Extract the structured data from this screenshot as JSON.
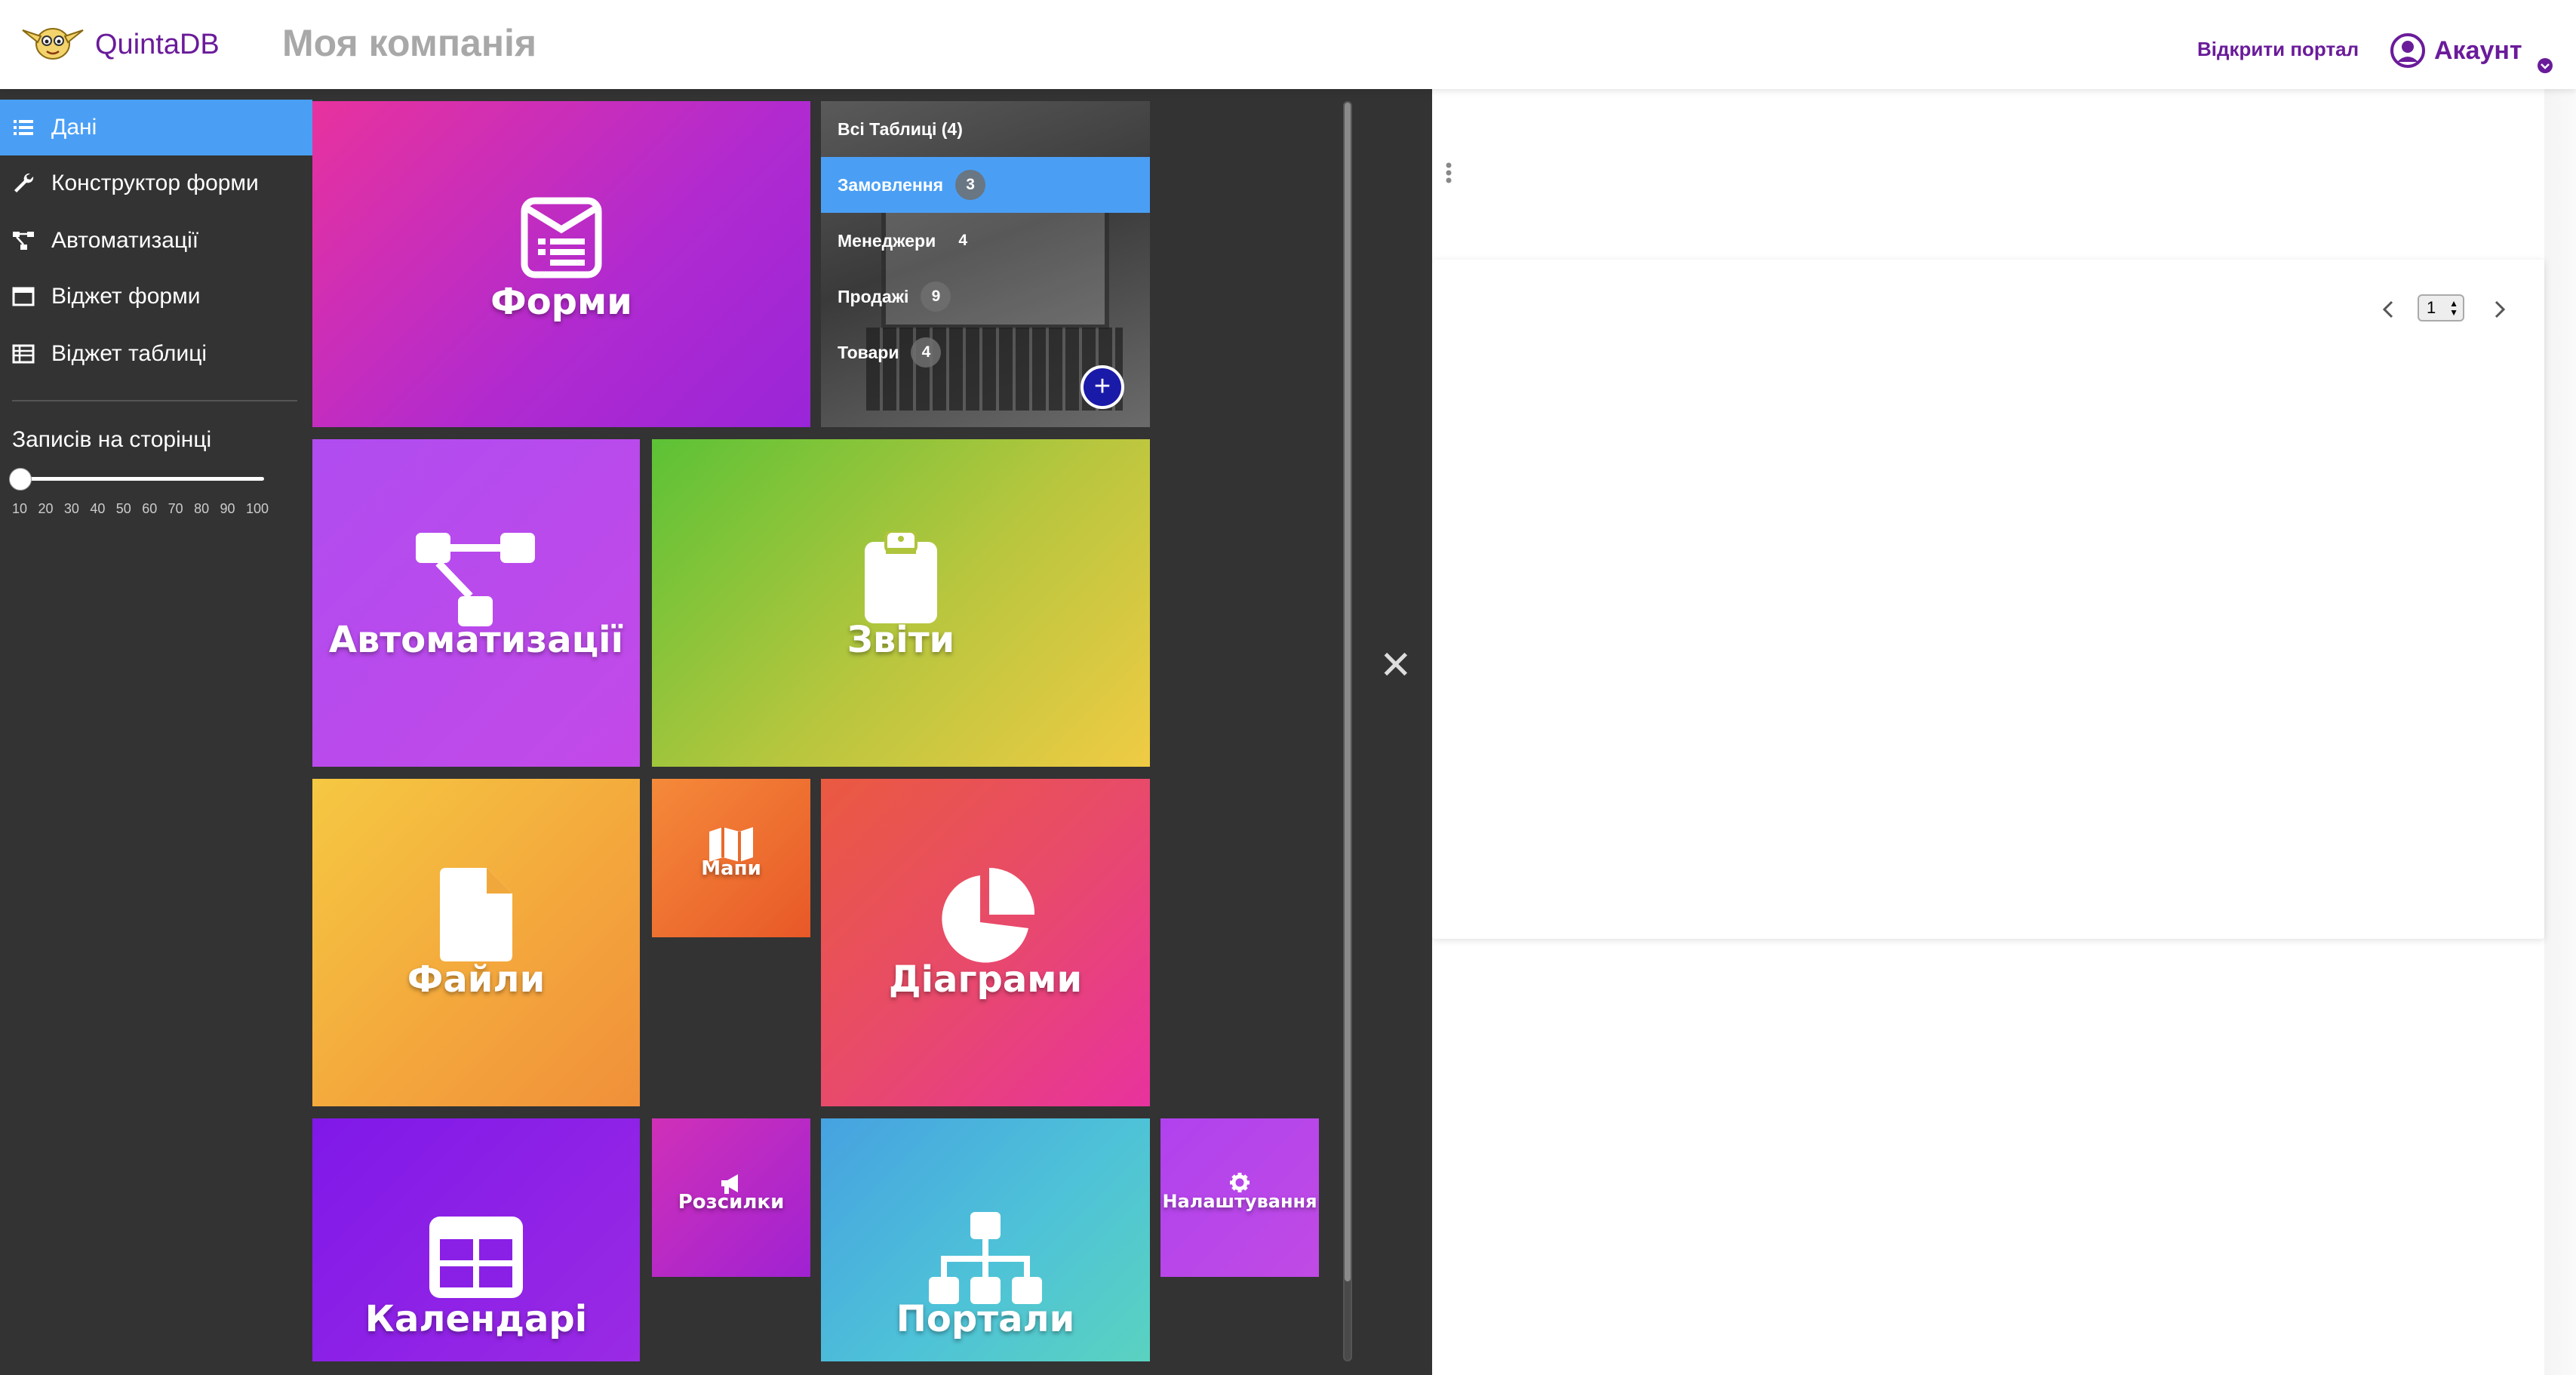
{
  "header": {
    "brand": "QuintaDB",
    "company": "Моя компанія",
    "portal_link": "Відкрити портал",
    "account": "Акаунт"
  },
  "sidebar": {
    "items": [
      {
        "label": "Дані",
        "icon": "list-icon",
        "active": true
      },
      {
        "label": "Конструктор форми",
        "icon": "wrench-icon"
      },
      {
        "label": "Автоматизації",
        "icon": "sitemap-icon"
      },
      {
        "label": "Віджет форми",
        "icon": "window-icon"
      },
      {
        "label": "Віджет таблиці",
        "icon": "table-icon"
      }
    ],
    "per_page_title": "Записів на сторінці",
    "per_page_value": 10,
    "ticks": [
      "10",
      "20",
      "30",
      "40",
      "50",
      "60",
      "70",
      "80",
      "90",
      "100"
    ]
  },
  "tables": {
    "all_label": "Всі Таблиці (4)",
    "rows": [
      {
        "name": "Замовлення",
        "count": "3",
        "active": true
      },
      {
        "name": "Менеджери",
        "count": "4"
      },
      {
        "name": "Продажі",
        "count": "9"
      },
      {
        "name": "Товари",
        "count": "4"
      }
    ],
    "add_label": "+"
  },
  "tiles": {
    "forms": "Форми",
    "automations": "Автоматизації",
    "reports": "Звіти",
    "files": "Файли",
    "maps": "Мапи",
    "charts": "Діаграми",
    "calendars": "Календарі",
    "mailings": "Розсилки",
    "portals": "Портали",
    "settings": "Налаштування"
  },
  "pager": {
    "page": "1"
  },
  "colors": {
    "accent": "#4a9ff5",
    "brand": "#6a1b9a",
    "overlay": "#333333"
  }
}
